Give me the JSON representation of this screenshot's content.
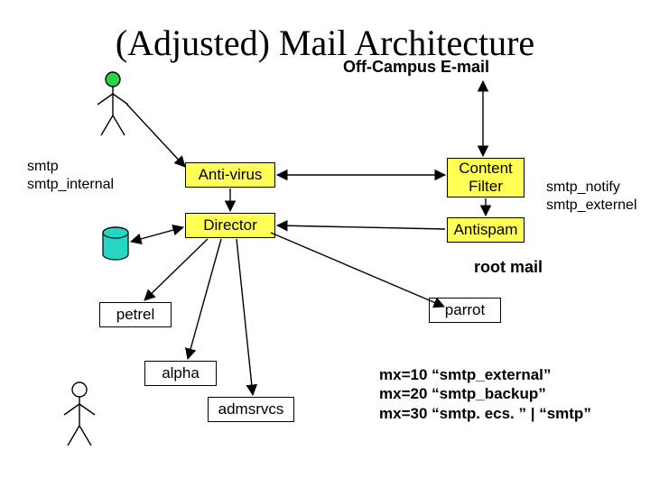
{
  "title": "(Adjusted) Mail Architecture",
  "subtitle": "Off-Campus E-mail",
  "labels": {
    "smtp_internal": "smtp\nsmtp_internal",
    "smtp_external_side": "smtp_notify\nsmtp_externel",
    "root_mail": "root mail",
    "mx_lines": "mx=10 “smtp_external”\nmx=20 “smtp_backup”\nmx=30 “smtp. ecs. ” | “smtp”"
  },
  "nodes": {
    "antivirus": "Anti-virus",
    "director": "Director",
    "content_filter": "Content\nFilter",
    "antispam": "Antispam",
    "petrel": "petrel",
    "parrot": "parrot",
    "alpha": "alpha",
    "admsrvcs": "admsrvcs"
  }
}
